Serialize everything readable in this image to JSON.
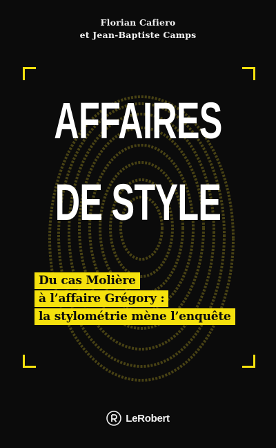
{
  "cover": {
    "authors": [
      "Florian Cafiero",
      "et Jean-Baptiste Camps"
    ],
    "title_lines": [
      "AFFAIRES",
      "DE STYLE"
    ],
    "subtitle_lines": [
      "Du cas Molière",
      "à l’affaire Grégory :",
      "la stylométrie mène l’enquête"
    ],
    "publisher": "LeRobert",
    "colors": {
      "background": "#0b0b0b",
      "accent_yellow": "#f5e10d",
      "title_white": "#ffffff"
    },
    "icons": [
      "fingerprint-icon",
      "publisher-logo-icon"
    ]
  }
}
